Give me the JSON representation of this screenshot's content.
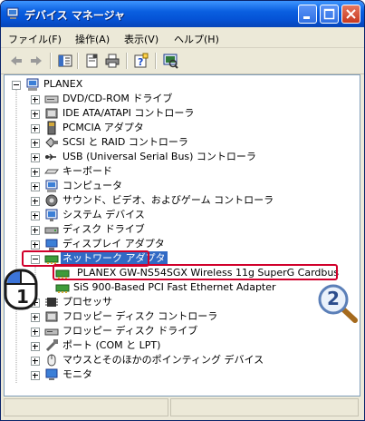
{
  "window": {
    "title": "デバイス マネージャ"
  },
  "menu": [
    "ファイル(F)",
    "操作(A)",
    "表示(V)",
    "ヘルプ(H)"
  ],
  "tree": {
    "root": "PLANEX",
    "categories": [
      {
        "label": "DVD/CD-ROM ドライブ",
        "icon": "dvd-drive-icon"
      },
      {
        "label": "IDE ATA/ATAPI コントローラ",
        "icon": "ide-controller-icon"
      },
      {
        "label": "PCMCIA アダプタ",
        "icon": "pcmcia-icon"
      },
      {
        "label": "SCSI と RAID コントローラ",
        "icon": "scsi-icon"
      },
      {
        "label": "USB (Universal Serial Bus) コントローラ",
        "icon": "usb-icon"
      },
      {
        "label": "キーボード",
        "icon": "keyboard-icon"
      },
      {
        "label": "コンピュータ",
        "icon": "computer-icon"
      },
      {
        "label": "サウンド、ビデオ、およびゲーム コントローラ",
        "icon": "sound-icon"
      },
      {
        "label": "システム デバイス",
        "icon": "system-device-icon"
      },
      {
        "label": "ディスク ドライブ",
        "icon": "disk-drive-icon"
      },
      {
        "label": "ディスプレイ アダプタ",
        "icon": "display-adapter-icon"
      }
    ],
    "network": {
      "label": "ネットワーク アダプタ",
      "children": [
        "PLANEX GW-NS54SGX Wireless 11g SuperG Cardbus",
        "SiS 900-Based PCI Fast Ethernet Adapter"
      ]
    },
    "after": [
      {
        "label": "プロセッサ",
        "icon": "processor-icon"
      },
      {
        "label": "フロッピー ディスク コントローラ",
        "icon": "floppy-controller-icon"
      },
      {
        "label": "フロッピー ディスク ドライブ",
        "icon": "floppy-drive-icon"
      },
      {
        "label": "ポート (COM と LPT)",
        "icon": "port-icon"
      },
      {
        "label": "マウスとそのほかのポインティング デバイス",
        "icon": "mouse-icon"
      },
      {
        "label": "モニタ",
        "icon": "monitor-icon"
      }
    ]
  },
  "annotations": {
    "step1": "1",
    "step2": "2"
  },
  "colors": {
    "highlight": "#d1002b",
    "selection": "#316ac5",
    "title": "#0553d6"
  }
}
